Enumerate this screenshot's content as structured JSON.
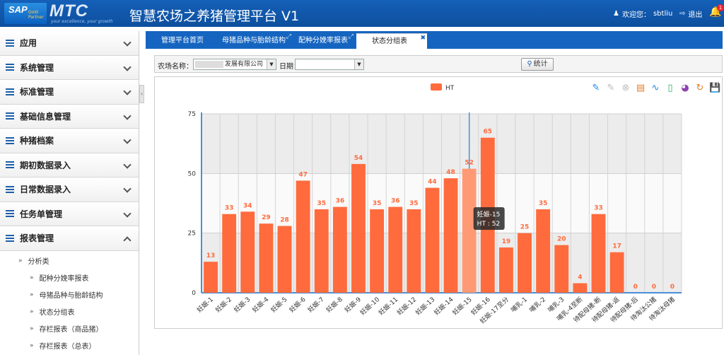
{
  "header": {
    "logo_sap": "SAP",
    "logo_sap_sub": "Gold Partner",
    "logo_mtc": "MTC",
    "logo_tagline": "your excellence, your growth",
    "title": "智慧农场之养猪管理平台 V1",
    "welcome": "欢迎您：",
    "username": "sbtliu",
    "logout": "退出",
    "badge_count": "1"
  },
  "sidebar": {
    "items": [
      {
        "label": "应用"
      },
      {
        "label": "系统管理"
      },
      {
        "label": "标准管理"
      },
      {
        "label": "基础信息管理"
      },
      {
        "label": "种猪档案"
      },
      {
        "label": "期初数据录入"
      },
      {
        "label": "日常数据录入"
      },
      {
        "label": "任务单管理"
      },
      {
        "label": "报表管理"
      }
    ],
    "subgroup": "分析类",
    "subitems": [
      "配种分娩率报表",
      "母猪品种与胎龄结构",
      "状态分组表",
      "存栏报表（商品猪）",
      "存栏报表（总表）"
    ]
  },
  "tabs": [
    {
      "label": "管理平台首页"
    },
    {
      "label": "母猪品种与胎龄结构"
    },
    {
      "label": "配种分娩率报表"
    },
    {
      "label": "状态分组表"
    }
  ],
  "filters": {
    "farm_label": "农场名称：",
    "farm_value": "发展有限公司",
    "date_label": "日期：",
    "date_value": "",
    "stat_button": "统计"
  },
  "colors": {
    "header_blue": "#1560b8",
    "tab_blue": "#1565c0",
    "bar": "#ff6b3d",
    "bar_highlight": "#ff9a74",
    "label": "#ff6b3d"
  },
  "icons": [
    "pencil-icon",
    "eraser-icon",
    "clear-icon",
    "data-view-icon",
    "line-chart-icon",
    "bar-chart-icon",
    "pie-chart-icon",
    "refresh-icon",
    "save-icon"
  ],
  "chart_data": {
    "type": "bar",
    "legend": [
      "HT"
    ],
    "legend_position": "top-center",
    "ylim": [
      0,
      75
    ],
    "yticks": [
      0,
      25,
      50,
      75
    ],
    "grid": true,
    "categories": [
      "妊娠-1",
      "妊娠-2",
      "妊娠-3",
      "妊娠-4",
      "妊娠-5",
      "妊娠-6",
      "妊娠-7",
      "妊娠-8",
      "妊娠-9",
      "妊娠-10",
      "妊娠-11",
      "妊娠-12",
      "妊娠-13",
      "妊娠-14",
      "妊娠-15",
      "妊娠-16",
      "妊娠-17至分",
      "哺乳-1",
      "哺乳-2",
      "哺乳-3",
      "哺乳-4至断",
      "待配母猪-断",
      "待配母猪-返",
      "待配母猪-后",
      "待淘汰公猪",
      "待淘汰母猪"
    ],
    "series": [
      {
        "name": "HT",
        "values": [
          13,
          33,
          34,
          29,
          28,
          47,
          35,
          36,
          54,
          35,
          36,
          35,
          44,
          48,
          52,
          65,
          19,
          25,
          35,
          20,
          4,
          33,
          17,
          0,
          0,
          0
        ]
      }
    ],
    "tooltip": {
      "category": "妊娠-15",
      "text": "HT : 52"
    }
  }
}
